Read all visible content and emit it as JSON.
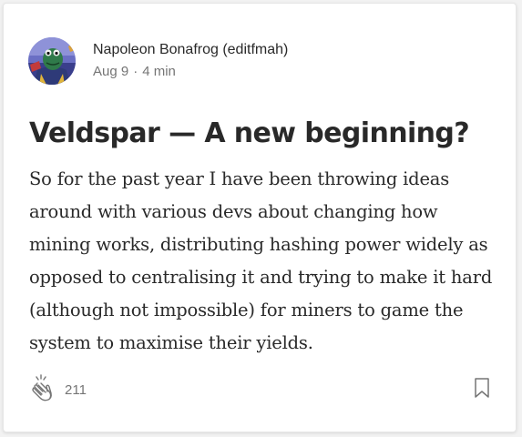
{
  "post": {
    "author_name": "Napoleon Bonafrog (editfmah)",
    "date": "Aug 9",
    "separator": "·",
    "read_time": "4 min",
    "title": "Veldspar — A new beginning?",
    "excerpt": "So for the past year I have been throwing ideas around with various devs about changing how mining works, distributing hashing power widely as opposed to centralising it and trying to make it hard (although not impossible) for miners to game the system to maximise their yields.",
    "clap_count": "211"
  },
  "icons": {
    "clap": "clap-icon",
    "bookmark": "bookmark-icon",
    "avatar": "author-avatar"
  },
  "colors": {
    "text_primary": "#292929",
    "text_secondary": "#757575",
    "card_bg": "#ffffff",
    "page_bg": "#f2f2f2"
  }
}
